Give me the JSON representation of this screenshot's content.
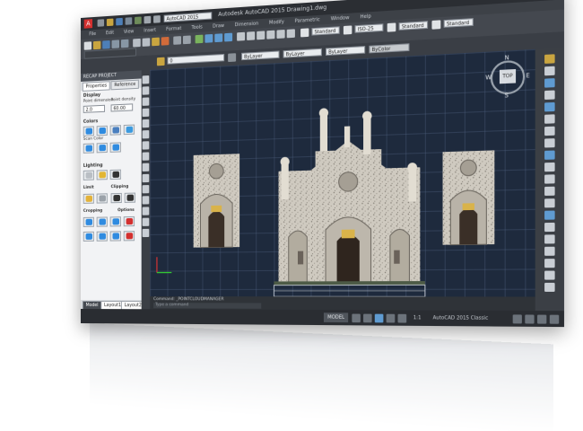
{
  "app": {
    "title": "Autodesk AutoCAD 2015 Drawing1.dwg",
    "workspace": "AutoCAD 2015 Classic",
    "colors": {
      "accent": "#d3302f",
      "viewport": "#1e2a3d",
      "chrome": "#3a3d43",
      "palette": "#f2f3f5"
    }
  },
  "menubar": [
    "File",
    "Edit",
    "View",
    "Insert",
    "Format",
    "Tools",
    "Draw",
    "Dimension",
    "Modify",
    "Parametric",
    "Window",
    "Help"
  ],
  "toolbar": {
    "style_dropdown": "Standard",
    "dim_dropdown": "ISO-25",
    "table_dropdown": "Standard",
    "mleader_dropdown": "Standard",
    "layer_dropdown": "0",
    "color_dropdown": "ByLayer",
    "linetype_dropdown": "ByLayer",
    "lineweight_dropdown": "ByLayer",
    "plot_dropdown": "ByColor"
  },
  "palette": {
    "header": "RECAP PROJECT",
    "tabs": [
      "Properties",
      "Reference"
    ],
    "section_display": "Display",
    "point_dimension_label": "Point dimension",
    "point_dimension_value": "2.0",
    "point_density_label": "Point density",
    "point_density_value": "60.00",
    "section_colors": "Colors",
    "color_buttons": [
      "Scan Color",
      "Normal",
      "Intensity",
      "Elevation",
      "Single",
      "Object",
      "Flip"
    ],
    "section_lighting": "Lighting",
    "lighting_buttons": [
      "None",
      "Point",
      "Point+Spec"
    ],
    "section_limit": "Limit",
    "section_clipping": "Clipping",
    "limit_buttons": [
      "Intensity",
      "Elevation",
      "Off"
    ],
    "clipping_buttons": [
      "Cropping",
      "Polygonal",
      "Rect"
    ],
    "section_cropping": "Cropping",
    "section_options": "Options",
    "cropping_buttons": [
      "Box",
      "Polygonal",
      "Cylinder",
      "Inverted",
      "Relative",
      "Preserve"
    ],
    "bottom_tabs": [
      "Model",
      "Layout1",
      "Layout2"
    ]
  },
  "viewcube": {
    "top_label": "TOP",
    "n": "N",
    "s": "S",
    "e": "E",
    "w": "W"
  },
  "command_line": {
    "history": "Command: _POINTCLOUDMANAGER",
    "prompt": "Type a command"
  },
  "statusbar": {
    "mode": "MODEL",
    "scale": "1:1",
    "workspace_label": "AutoCAD 2015 Classic"
  }
}
